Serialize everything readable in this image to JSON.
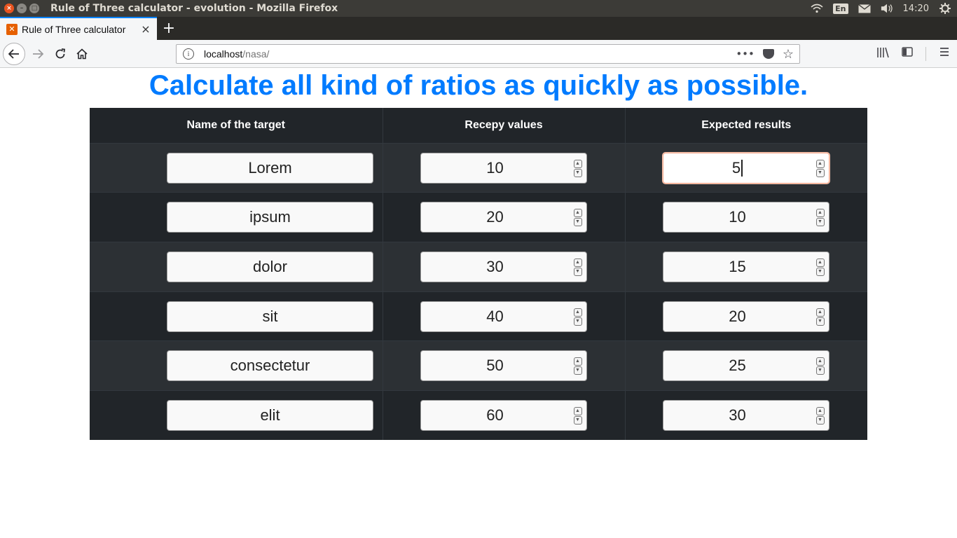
{
  "window": {
    "title": "Rule of Three calculator - evolution - Mozilla Firefox",
    "close_glyph": "×",
    "min_glyph": "–",
    "max_glyph": "□"
  },
  "system_tray": {
    "language": "En",
    "time": "14:20",
    "icons": [
      "wifi-icon",
      "keyboard-language-icon",
      "mail-icon",
      "volume-icon",
      "power-settings-icon"
    ]
  },
  "browser": {
    "tab_title": "Rule of Three calculator",
    "tab_close": "×",
    "new_tab": "+",
    "url_host": "localhost",
    "url_path": "/nasa/",
    "page_actions": "•••",
    "bookmark_star": "☆"
  },
  "page": {
    "heading": "Calculate all kind of ratios as quickly as possible.",
    "columns": {
      "name": "Name of the target",
      "recepy": "Recepy values",
      "expected": "Expected results"
    },
    "rows": [
      {
        "name": "Lorem",
        "recepy": "10",
        "expected": "5"
      },
      {
        "name": "ipsum",
        "recepy": "20",
        "expected": "10"
      },
      {
        "name": "dolor",
        "recepy": "30",
        "expected": "15"
      },
      {
        "name": "sit",
        "recepy": "40",
        "expected": "20"
      },
      {
        "name": "consectetur",
        "recepy": "50",
        "expected": "25"
      },
      {
        "name": "elit",
        "recepy": "60",
        "expected": "30"
      }
    ],
    "focused_field": "expected-0",
    "colors": {
      "heading": "#007bff",
      "table_bg": "#212529",
      "focus_border": "#f2a98c"
    }
  }
}
